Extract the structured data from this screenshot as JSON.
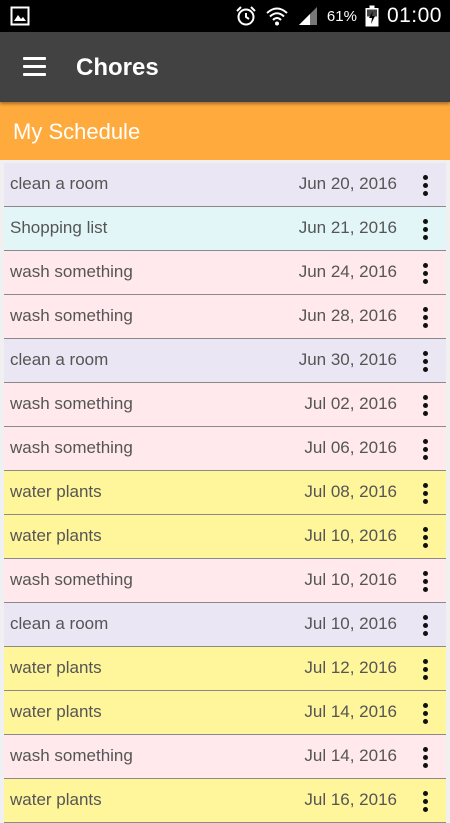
{
  "status_bar": {
    "battery_percent": "61%",
    "time": "01:00",
    "icons": [
      "image-icon",
      "alarm-icon",
      "wifi-icon",
      "signal-icon",
      "battery-charging-icon"
    ]
  },
  "app_bar": {
    "title": "Chores",
    "menu_icon": "hamburger-menu-icon"
  },
  "section": {
    "title": "My Schedule",
    "color": "#ffaa3c"
  },
  "colors": {
    "clean": "#ebe6f4",
    "shopping": "#e2f6f8",
    "wash": "#ffe9ec",
    "water": "#fff59a"
  },
  "chores": [
    {
      "name": "clean a room",
      "date": "Jun 20, 2016",
      "color": "#ebe6f4"
    },
    {
      "name": "Shopping list",
      "date": "Jun 21, 2016",
      "color": "#e2f6f8"
    },
    {
      "name": "wash something",
      "date": "Jun 24, 2016",
      "color": "#ffe9ec"
    },
    {
      "name": "wash something",
      "date": "Jun 28, 2016",
      "color": "#ffe9ec"
    },
    {
      "name": "clean a room",
      "date": "Jun 30, 2016",
      "color": "#ebe6f4"
    },
    {
      "name": "wash something",
      "date": "Jul 02, 2016",
      "color": "#ffe9ec"
    },
    {
      "name": "wash something",
      "date": "Jul 06, 2016",
      "color": "#ffe9ec"
    },
    {
      "name": "water plants",
      "date": "Jul 08, 2016",
      "color": "#fff59a"
    },
    {
      "name": "water plants",
      "date": "Jul 10, 2016",
      "color": "#fff59a"
    },
    {
      "name": "wash something",
      "date": "Jul 10, 2016",
      "color": "#ffe9ec"
    },
    {
      "name": "clean a room",
      "date": "Jul 10, 2016",
      "color": "#ebe6f4"
    },
    {
      "name": "water plants",
      "date": "Jul 12, 2016",
      "color": "#fff59a"
    },
    {
      "name": "water plants",
      "date": "Jul 14, 2016",
      "color": "#fff59a"
    },
    {
      "name": "wash something",
      "date": "Jul 14, 2016",
      "color": "#ffe9ec"
    },
    {
      "name": "water plants",
      "date": "Jul 16, 2016",
      "color": "#fff59a"
    }
  ]
}
